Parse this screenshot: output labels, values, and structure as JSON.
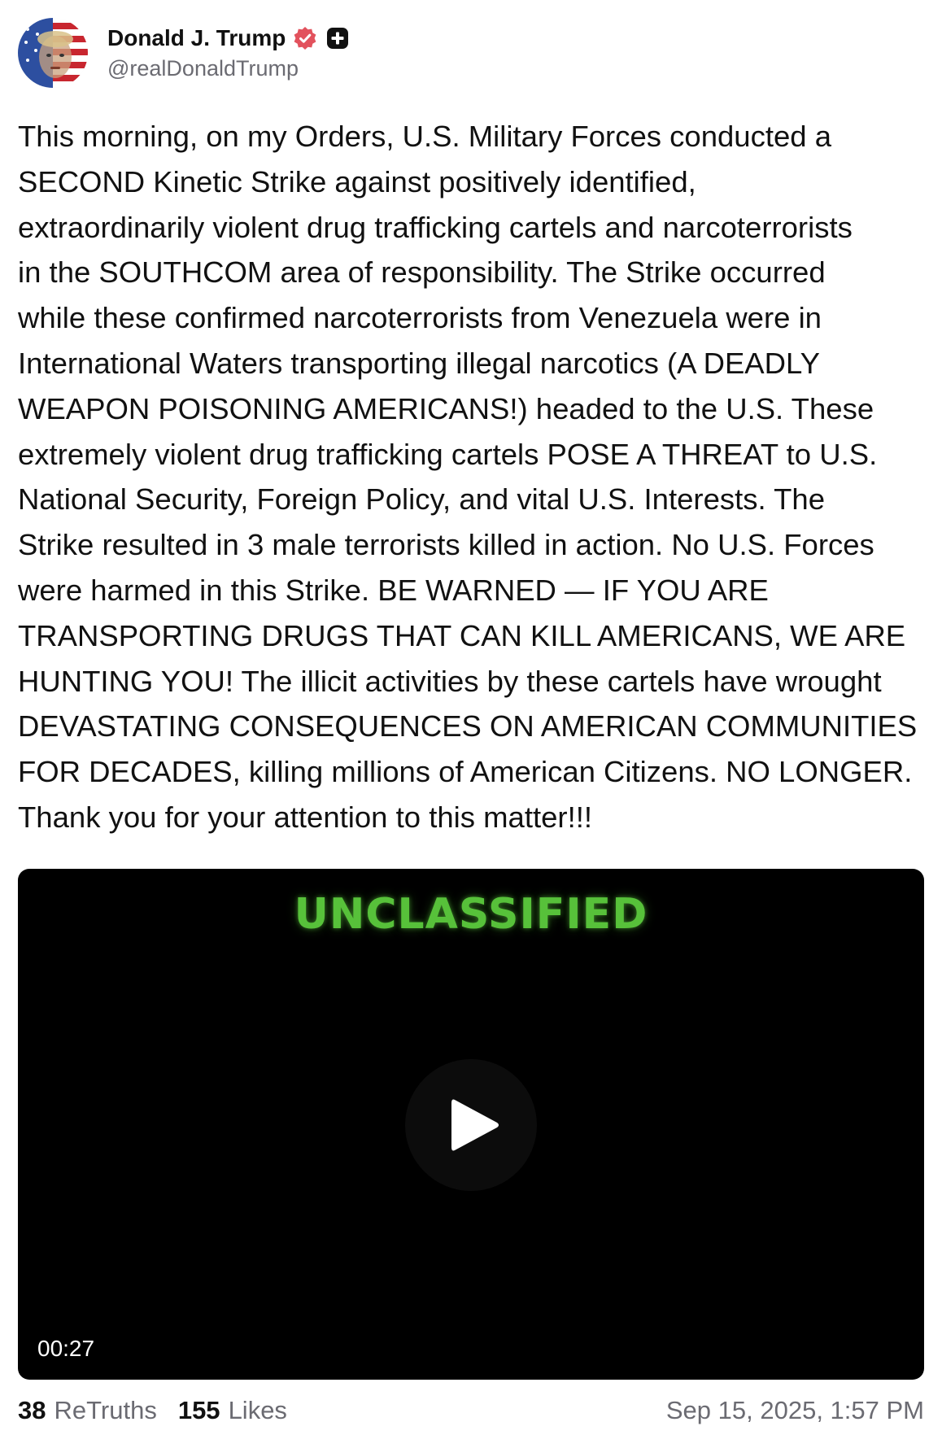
{
  "author": {
    "display_name": "Donald J. Trump",
    "handle": "@realDonaldTrump",
    "avatar_icon": "avatar-flag-portrait",
    "verified_icon": "verified-badge-icon",
    "verified_color": "#e2525d",
    "plus_icon": "plus-badge-icon"
  },
  "post": {
    "text": "This morning, on my Orders, U.S. Military Forces conducted a\nSECOND Kinetic Strike against positively identified,\nextraordinarily violent drug trafficking cartels and narcoterrorists\nin the SOUTHCOM area of responsibility. The Strike occurred\nwhile these confirmed narcoterrorists from Venezuela were in\nInternational Waters transporting illegal narcotics (A DEADLY\nWEAPON POISONING AMERICANS!) headed to the U.S. These\nextremely violent drug trafficking cartels POSE A THREAT to U.S.\nNational Security, Foreign Policy, and vital U.S. Interests. The\nStrike resulted in 3 male terrorists killed in action. No U.S. Forces\nwere harmed in this Strike. BE WARNED — IF YOU ARE\nTRANSPORTING DRUGS THAT CAN KILL AMERICANS, WE ARE\nHUNTING YOU! The illicit activities by these cartels have wrought\nDEVASTATING CONSEQUENCES ON AMERICAN COMMUNITIES\nFOR DECADES, killing millions of American Citizens. NO LONGER.\nThank you for your attention to this matter!!!"
  },
  "video": {
    "overlay_text": "UNCLASSIFIED",
    "overlay_color": "#57c13a",
    "duration": "00:27",
    "play_icon": "play-icon"
  },
  "stats": {
    "retruths_count": "38",
    "retruths_label": "ReTruths",
    "likes_count": "155",
    "likes_label": "Likes",
    "timestamp": "Sep 15, 2025, 1:57 PM"
  }
}
